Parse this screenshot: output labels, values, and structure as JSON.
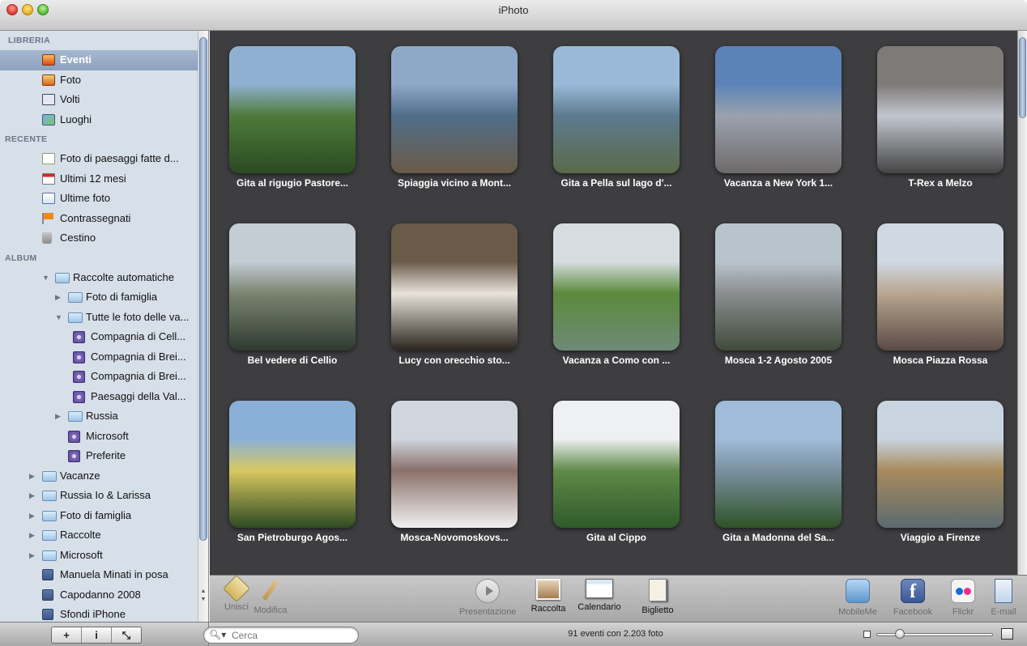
{
  "window": {
    "title": "iPhoto"
  },
  "sidebar": {
    "sections": {
      "libreria": "LIBRERIA",
      "recente": "RECENTE",
      "album": "ALBUM"
    },
    "libreria": [
      {
        "label": "Eventi",
        "icon": "events-icon",
        "selected": true
      },
      {
        "label": "Foto",
        "icon": "photos-icon"
      },
      {
        "label": "Volti",
        "icon": "faces-icon"
      },
      {
        "label": "Luoghi",
        "icon": "places-icon"
      }
    ],
    "recente": [
      {
        "label": "Foto di paesaggi fatte d...",
        "icon": "smart-event-icon"
      },
      {
        "label": "Ultimi 12 mesi",
        "icon": "calendar-icon"
      },
      {
        "label": "Ultime foto",
        "icon": "import-icon"
      },
      {
        "label": "Contrassegnati",
        "icon": "flag-icon"
      },
      {
        "label": "Cestino",
        "icon": "trash-icon"
      }
    ],
    "album": [
      {
        "label": "Raccolte automatiche",
        "icon": "folder-icon",
        "level": 1,
        "tri": "open"
      },
      {
        "label": "Foto di famiglia",
        "icon": "folder-icon",
        "level": 2,
        "tri": "closed"
      },
      {
        "label": "Tutte le foto delle va...",
        "icon": "folder-icon",
        "level": 2,
        "tri": "open"
      },
      {
        "label": "Compagnia di Cell...",
        "icon": "smart-album-icon",
        "level": 3
      },
      {
        "label": "Compagnia di Brei...",
        "icon": "smart-album-icon",
        "level": 3
      },
      {
        "label": "Compagnia di Brei...",
        "icon": "smart-album-icon",
        "level": 3
      },
      {
        "label": "Paesaggi della Val...",
        "icon": "smart-album-icon",
        "level": 3
      },
      {
        "label": "Russia",
        "icon": "folder-icon",
        "level": 2,
        "tri": "closed"
      },
      {
        "label": "Microsoft",
        "icon": "smart-album-icon",
        "level": 2
      },
      {
        "label": "Preferite",
        "icon": "smart-album-icon",
        "level": 2
      },
      {
        "label": "Vacanze",
        "icon": "folder-icon",
        "level": 0,
        "tri": "closed"
      },
      {
        "label": "Russia Io & Larissa",
        "icon": "folder-icon",
        "level": 0,
        "tri": "closed"
      },
      {
        "label": "Foto di famiglia",
        "icon": "folder-icon",
        "level": 0,
        "tri": "closed"
      },
      {
        "label": "Raccolte",
        "icon": "folder-icon",
        "level": 0,
        "tri": "closed"
      },
      {
        "label": "Microsoft",
        "icon": "folder-icon",
        "level": 0,
        "tri": "closed"
      },
      {
        "label": "Manuela Minati in posa",
        "icon": "album-icon",
        "level": 0
      },
      {
        "label": "Capodanno 2008",
        "icon": "album-icon",
        "level": 0
      },
      {
        "label": "Sfondi iPhone",
        "icon": "album-icon",
        "level": 0
      }
    ]
  },
  "events": [
    {
      "title": "Gita al rigugio Pastore...",
      "colors": [
        "#8fb0d0",
        "#4d7a3a",
        "#2b4a22"
      ]
    },
    {
      "title": "Spiaggia vicino a Mont...",
      "colors": [
        "#8ea8c8",
        "#4f6d88",
        "#6b5a48"
      ]
    },
    {
      "title": "Gita a Pella sul lago d'...",
      "colors": [
        "#9ab9d8",
        "#5d7b8e",
        "#5a6a4a"
      ]
    },
    {
      "title": "Vacanza a New York 1...",
      "colors": [
        "#5c83b8",
        "#9aa2ae",
        "#6e6a6a"
      ]
    },
    {
      "title": "T-Rex a Melzo",
      "colors": [
        "#7e7a78",
        "#c2c6cf",
        "#444444"
      ]
    },
    {
      "title": "Bel vedere di Cellio",
      "colors": [
        "#c4ccd4",
        "#7a8470",
        "#2f3a30"
      ]
    },
    {
      "title": "Lucy con orecchio sto...",
      "colors": [
        "#6a5a48",
        "#e8e2da",
        "#2a241e"
      ]
    },
    {
      "title": "Vacanza a Como con ...",
      "colors": [
        "#d6dde0",
        "#5b8a3c",
        "#6f8a78"
      ]
    },
    {
      "title": "Mosca 1-2 Agosto 2005",
      "colors": [
        "#b8c4cc",
        "#8a8e90",
        "#3f4b3a"
      ]
    },
    {
      "title": "Mosca Piazza Rossa",
      "colors": [
        "#d0d8e2",
        "#b8a690",
        "#5a4a44"
      ]
    },
    {
      "title": "San Pietroburgo Agos...",
      "colors": [
        "#8ab0d8",
        "#d8c860",
        "#2d4a22"
      ]
    },
    {
      "title": "Mosca-Novomoskovs...",
      "colors": [
        "#cfd6de",
        "#8a7068",
        "#f0f0f0"
      ]
    },
    {
      "title": "Gita al Cippo",
      "colors": [
        "#eef0f2",
        "#5f8a48",
        "#2f5a2a"
      ]
    },
    {
      "title": "Gita a Madonna del Sa...",
      "colors": [
        "#a0bcd8",
        "#7a90a0",
        "#2e5226"
      ]
    },
    {
      "title": "Viaggio a Firenze",
      "colors": [
        "#c8d4e0",
        "#a88a5c",
        "#5a6a70"
      ]
    }
  ],
  "toolbar": {
    "left": [
      {
        "label": "Unisci",
        "icon": "merge-icon"
      },
      {
        "label": "Modifica",
        "icon": "pencil-icon"
      }
    ],
    "center": [
      {
        "label": "Presentazione",
        "icon": "play-icon"
      },
      {
        "label": "Raccolta",
        "icon": "book-icon"
      },
      {
        "label": "Calendario",
        "icon": "calendar-icon"
      },
      {
        "label": "Biglietto",
        "icon": "card-icon"
      }
    ],
    "right": [
      {
        "label": "MobileMe",
        "icon": "mobileme-icon"
      },
      {
        "label": "Facebook",
        "icon": "facebook-icon",
        "glyph": "f"
      },
      {
        "label": "Flickr",
        "icon": "flickr-icon"
      },
      {
        "label": "E-mail",
        "icon": "email-icon"
      }
    ]
  },
  "bottom": {
    "buttons": [
      "+",
      "i",
      "⤡"
    ],
    "search_placeholder": "Cerca",
    "status": "91 eventi con 2.203 foto",
    "zoom_level": 0.2
  }
}
